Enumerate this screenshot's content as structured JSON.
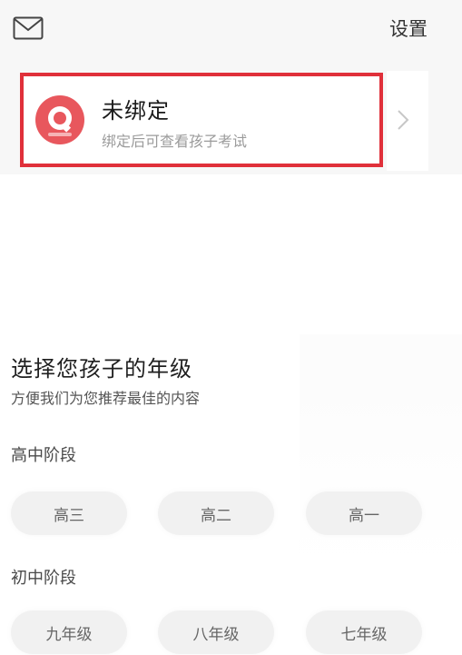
{
  "header": {
    "settings_label": "设置"
  },
  "bind_card": {
    "title": "未绑定",
    "subtitle": "绑定后可查看孩子考试"
  },
  "grade_section": {
    "title": "选择您孩子的年级",
    "subtitle": "方便我们为您推荐最佳的内容",
    "stages": [
      {
        "label": "高中阶段",
        "grades": [
          "高三",
          "高二",
          "高一"
        ]
      },
      {
        "label": "初中阶段",
        "grades": [
          "九年级",
          "八年级",
          "七年级"
        ]
      }
    ]
  },
  "icons": {
    "mail": "mail-icon",
    "chevron": "chevron-right-icon",
    "logo": "app-logo-icon"
  },
  "colors": {
    "highlight_border": "#e0303a",
    "logo_red": "#e8575d",
    "background": "#f7f7f7"
  }
}
